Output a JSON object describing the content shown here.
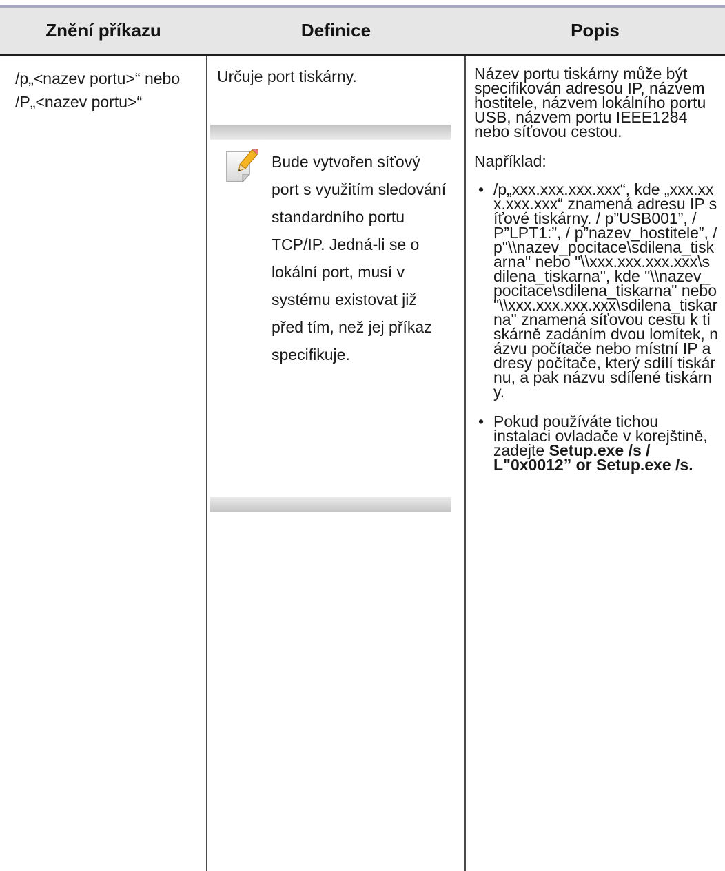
{
  "header": {
    "col1": "Znění příkazu",
    "col2": "Definice",
    "col3": "Popis"
  },
  "row": {
    "command": "/p„<nazev portu>“ nebo /P„<nazev portu>“",
    "definition": "Určuje port tiskárny.",
    "note": {
      "icon": "note-pencil-icon",
      "text": "Bude vytvořen síťový port s využitím sledování standardního portu TCP/IP. Jedná-li se o lokální port, musí v systému existovat již před tím, než jej příkaz specifikuje."
    },
    "description": {
      "intro": "Název portu tiskárny může být specifikován adresou IP, názvem hostitele, názvem lokálního portu USB, názvem portu IEEE1284 nebo síťovou cestou.",
      "example_label": "Například:",
      "bullet1": "/p„xxx.xxx.xxx.xxx“, kde „xxx.xxx.xxx.xxx“ znamená adresu IP síťové tiskárny. / p”USB001”, /P”LPT1:”, / p”nazev_hostitele”, / p\"\\\\nazev_pocitace\\sdilena_tiskarna\" nebo \"\\\\xxx.xxx.xxx.xxx\\sdilena_tiskarna\", kde \"\\\\nazev_pocitace\\sdilena_tiskarna\" nebo \"\\\\xxx.xxx.xxx.xxx\\sdilena_tiskarna\" znamená síťovou cestu k tiskárně zadáním dvou lomítek, názvu počítače nebo místní IP adresy počítače, který sdílí tiskárnu, a pak názvu sdílené tiskárny.",
      "bullet2_text": "Pokud používáte tichou instalaci ovladače v korejštině, zadejte",
      "bullet2_bold": "Setup.exe /s / L\"0x0012” or Setup.exe /s."
    }
  },
  "colors": {
    "header_bg": "#e6e6e6",
    "top_rule": "#a7a8c6"
  }
}
